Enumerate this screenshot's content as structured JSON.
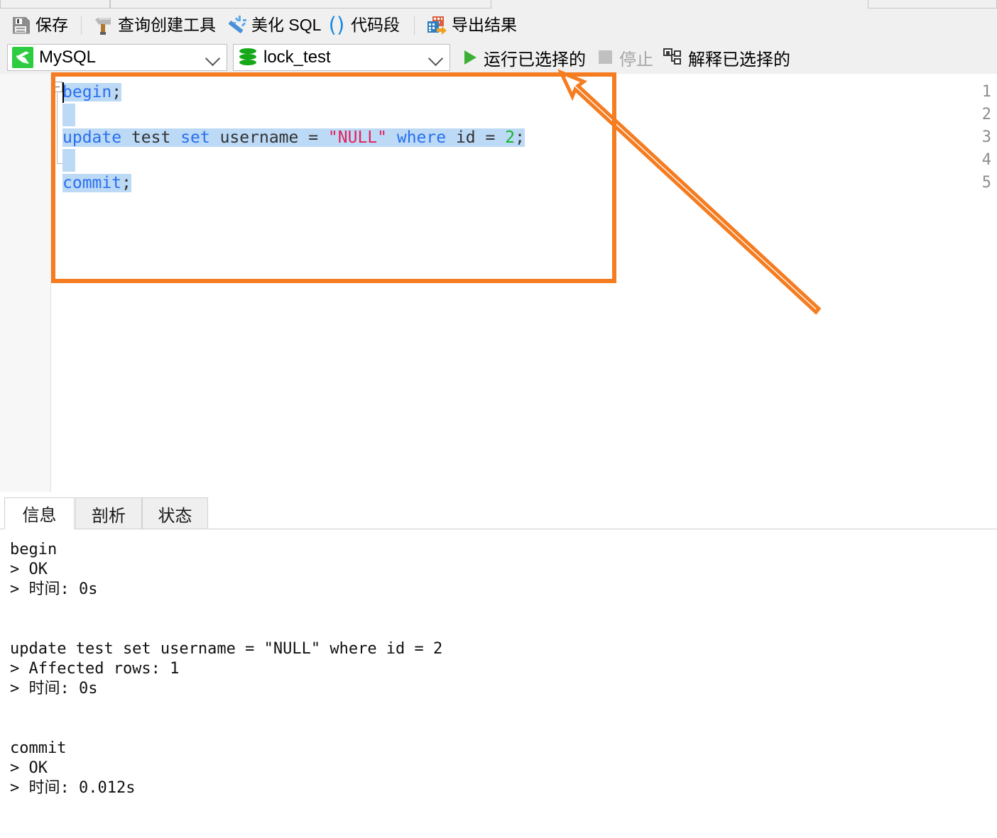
{
  "window": {
    "app_style": "navicat-sql-editor"
  },
  "toolbar": {
    "buttons": [
      {
        "label": "保存",
        "icon": "save-icon"
      },
      {
        "label": "查询创建工具",
        "icon": "hammer-icon"
      },
      {
        "label": "美化 SQL",
        "icon": "magic-wand-icon"
      },
      {
        "label": "代码段",
        "icon": "parentheses-icon"
      },
      {
        "label": "导出结果",
        "icon": "export-icon"
      }
    ]
  },
  "connection_bar": {
    "connection": {
      "value": "MySQL",
      "icon": "mysql-dolphin-icon"
    },
    "database": {
      "value": "lock_test",
      "icon": "database-icon"
    },
    "run_selected": {
      "label": "运行已选择的",
      "icon": "play-icon",
      "enabled": true
    },
    "stop": {
      "label": "停止",
      "icon": "stop-icon",
      "enabled": false
    },
    "explain_selected": {
      "label": "解释已选择的",
      "icon": "explain-icon",
      "enabled": true
    }
  },
  "editor": {
    "line_numbers": [
      "1",
      "2",
      "3",
      "4",
      "5"
    ],
    "fold_marker": "collapse-minus",
    "lines": [
      {
        "n": 1,
        "tokens": [
          {
            "t": "begin",
            "c": "kw"
          },
          {
            "t": ";",
            "c": "pn"
          }
        ],
        "selected": true
      },
      {
        "n": 2,
        "tokens": [],
        "selected": true
      },
      {
        "n": 3,
        "tokens": [
          {
            "t": "update",
            "c": "kw"
          },
          {
            "t": " test ",
            "c": "id"
          },
          {
            "t": "set",
            "c": "kw"
          },
          {
            "t": " username = ",
            "c": "id"
          },
          {
            "t": "\"NULL\"",
            "c": "str"
          },
          {
            "t": " ",
            "c": "id"
          },
          {
            "t": "where",
            "c": "kw"
          },
          {
            "t": " id = ",
            "c": "id"
          },
          {
            "t": "2",
            "c": "num"
          },
          {
            "t": ";",
            "c": "pn"
          }
        ],
        "selected": true
      },
      {
        "n": 4,
        "tokens": [],
        "selected": true
      },
      {
        "n": 5,
        "tokens": [
          {
            "t": "commit",
            "c": "kw"
          },
          {
            "t": ";",
            "c": "pn"
          }
        ],
        "selected": true
      }
    ],
    "plain_text": "begin;\n\nupdate test set username = \"NULL\" where id = 2;\n\ncommit;"
  },
  "results": {
    "tabs": [
      {
        "label": "信息",
        "active": true
      },
      {
        "label": "剖析",
        "active": false
      },
      {
        "label": "状态",
        "active": false
      }
    ],
    "output": "begin\n> OK\n> 时间: 0s\n\n\nupdate test set username = \"NULL\" where id = 2\n> Affected rows: 1\n> 时间: 0s\n\n\ncommit\n> OK\n> 时间: 0.012s",
    "output_lines": [
      "begin",
      "> OK",
      "> 时间: 0s",
      "",
      "",
      "update test set username = \"NULL\" where id = 2",
      "> Affected rows: 1",
      "> 时间: 0s",
      "",
      "",
      "commit",
      "> OK",
      "> 时间: 0.012s"
    ]
  },
  "annotations": {
    "orange_box": {
      "color": "#f57c20",
      "target": "sql-statements"
    },
    "orange_arrow": {
      "color": "#f57c20",
      "points_to": "run-selected-button"
    },
    "green_box": {
      "color": "#2bb14e",
      "target": "message-output"
    }
  },
  "colors": {
    "accent_orange": "#f57c20",
    "accent_green": "#2bb14e",
    "keyword_blue": "#2a6ff0",
    "string_red": "#e4205a",
    "number_green": "#16b52b",
    "selection_blue": "#bcd9f5",
    "toolbar_bg": "#f0f0f0"
  }
}
